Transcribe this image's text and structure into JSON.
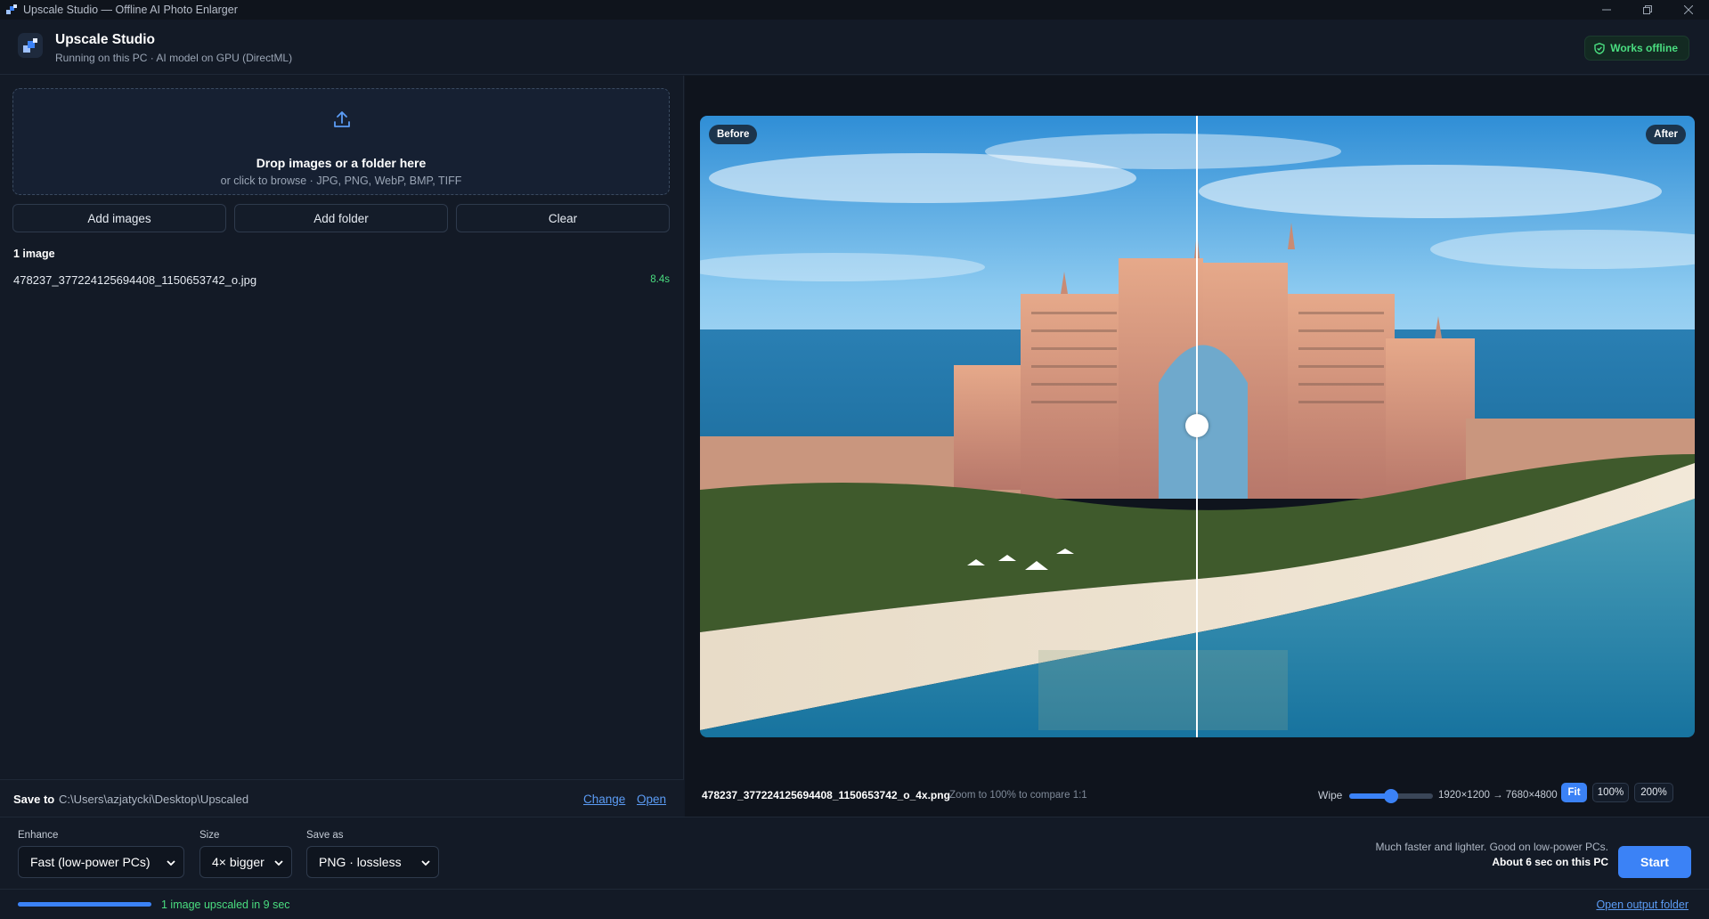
{
  "window": {
    "title": "Upscale Studio — Offline AI Photo Enlarger",
    "controls": [
      "minimize-icon",
      "restore-icon",
      "close-icon"
    ]
  },
  "header": {
    "app_name": "Upscale Studio",
    "subtitle": "Running on this PC · AI model on GPU (DirectML)",
    "badge": "Works offline",
    "badge_icon": "shield-check-icon"
  },
  "dropzone": {
    "icon": "upload-icon",
    "title": "Drop images or a folder here",
    "subtitle": "or click to browse · JPG, PNG, WebP, BMP, TIFF"
  },
  "buttons": {
    "add_images": "Add images",
    "add_folder": "Add folder",
    "clear": "Clear"
  },
  "files": {
    "count_label": "1 image",
    "items": [
      {
        "name": "478237_377224125694408_1150653742_o.jpg",
        "time": "8.4s"
      }
    ]
  },
  "save_to": {
    "label": "Save to",
    "path": "C:\\Users\\azjatycki\\Desktop\\Upscaled",
    "change": "Change",
    "open": "Open"
  },
  "preview": {
    "before_label": "Before",
    "after_label": "After",
    "wipe_fraction": 0.5
  },
  "viewer_bar": {
    "output_name": "478237_377224125694408_1150653742_o_4x.png",
    "zoom_hint": "Zoom to 100% to compare 1:1",
    "wipe_label": "Wipe",
    "wipe_value": 0.5,
    "resolution": "1920×1200 → 7680×4800",
    "zoom_options": [
      "Fit",
      "100%",
      "200%"
    ],
    "zoom_selected": "Fit"
  },
  "settings": {
    "enhance_label": "Enhance",
    "enhance_value": "Fast (low-power PCs)",
    "size_label": "Size",
    "size_value": "4× bigger",
    "save_as_label": "Save as",
    "save_as_value": "PNG · lossless",
    "hint_line1": "Much faster and lighter. Good on low-power PCs.",
    "hint_line2": "About 6 sec on this PC",
    "start": "Start"
  },
  "status": {
    "progress": 1.0,
    "text": "1 image upscaled in 9 sec",
    "open_output": "Open output folder"
  },
  "colors": {
    "accent": "#3b82f6",
    "success": "#4ade80",
    "background": "#131a26",
    "link": "#5b9cf5"
  }
}
